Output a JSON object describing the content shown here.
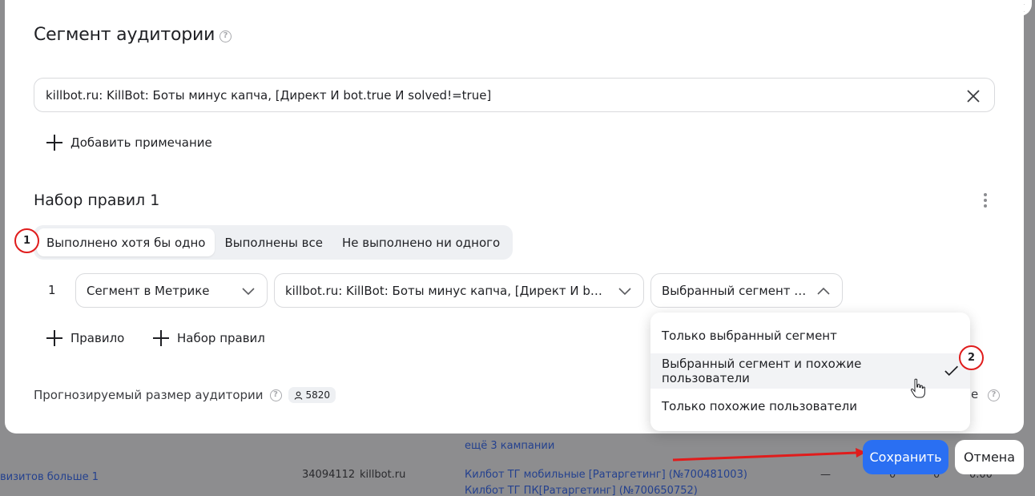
{
  "modal": {
    "title": "Сегмент аудитории",
    "name_input_value": "killbot.ru: KillBot: Боты минус капча, [Директ И bot.true И solved!=true]",
    "add_note_label": "Добавить примечание",
    "ruleset": {
      "title": "Набор правил 1",
      "condition_tabs": [
        {
          "label": "Выполнено хотя бы одно",
          "active": true
        },
        {
          "label": "Выполнены все",
          "active": false
        },
        {
          "label": "Не выполнено ни одного",
          "active": false
        }
      ],
      "rule": {
        "number": "1",
        "type_select": "Сегмент в Метрике",
        "segment_select": "killbot.ru: KillBot: Боты минус капча, [Директ И bot.tr...",
        "mode_select": "Выбранный сегмент и ..."
      },
      "add_rule_label": "Правило",
      "add_ruleset_label": "Набор правил"
    },
    "forecast": {
      "label": "Прогнозируемый размер аудитории",
      "value": "5820"
    },
    "hidden_text_fragment": "е"
  },
  "dropdown": {
    "options": [
      {
        "label": "Только выбранный сегмент",
        "selected": false
      },
      {
        "label": "Выбранный сегмент и похожие пользователи",
        "selected": true
      },
      {
        "label": "Только похожие пользователи",
        "selected": false
      }
    ]
  },
  "footer": {
    "save_label": "Сохранить",
    "cancel_label": "Отмена"
  },
  "markers": [
    "1",
    "2"
  ],
  "background": {
    "campaigns_more": "ещё 3 кампании",
    "row_name": "визитов больше 1",
    "row_id": "34094112",
    "row_site": "killbot.ru",
    "row_campaign_1": "Килбот ТГ мобильные [Ратаргетинг] (№700481003)",
    "row_campaign_2": "Килбот ТГ ПК[Ратаргетинг] (№700650752)",
    "row_dash": "—",
    "row_zero_1": "0",
    "row_zero_2": "0",
    "row_rate": "0.00"
  },
  "colors": {
    "accent": "#2a6ff2",
    "marker": "#e01c1c",
    "arrow": "#e01c1c"
  }
}
